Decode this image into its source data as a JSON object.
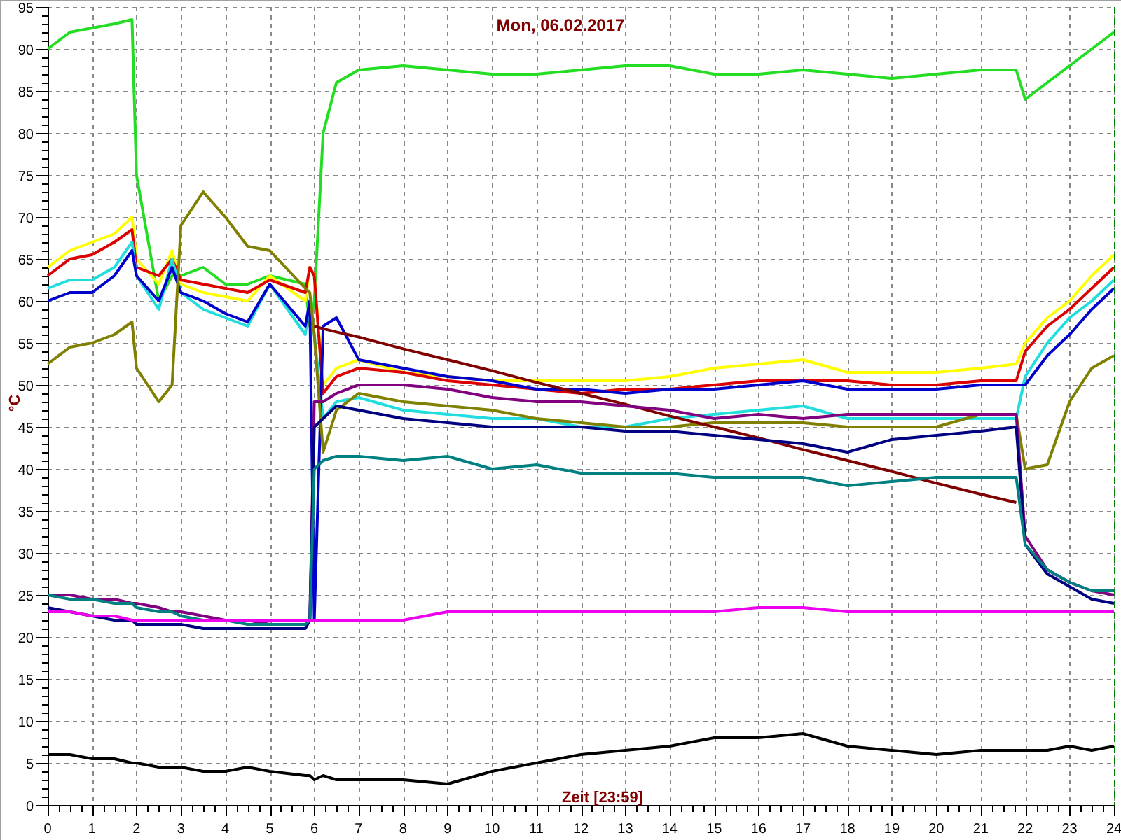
{
  "chart_data": {
    "type": "line",
    "title": "Mon, 06.02.2017",
    "xlabel": "Zeit [23:59]",
    "ylabel": "°C",
    "x": [
      0,
      0.5,
      1,
      1.5,
      1.9,
      2,
      2.5,
      2.8,
      3,
      3.5,
      4,
      4.5,
      5,
      5.8,
      5.9,
      6,
      6.2,
      6.5,
      7,
      8,
      9,
      10,
      11,
      12,
      13,
      14,
      15,
      16,
      17,
      18,
      19,
      20,
      21,
      21.8,
      22,
      22.5,
      23,
      23.5,
      24
    ],
    "grid": true,
    "xlim": [
      0,
      24
    ],
    "ylim": [
      0,
      95
    ],
    "xticks": [
      0,
      1,
      2,
      3,
      4,
      5,
      6,
      7,
      8,
      9,
      10,
      11,
      12,
      13,
      14,
      15,
      16,
      17,
      18,
      19,
      20,
      21,
      22,
      23,
      24
    ],
    "yticks": [
      0,
      5,
      10,
      15,
      20,
      25,
      30,
      35,
      40,
      45,
      50,
      55,
      60,
      65,
      70,
      75,
      80,
      85,
      90,
      95
    ],
    "series": [
      {
        "color": "#22dd22",
        "values": [
          90,
          92,
          92.5,
          93,
          93.5,
          75,
          60,
          63,
          63,
          64,
          62,
          62,
          63,
          62,
          57,
          60,
          80,
          86,
          87.5,
          88,
          87.5,
          87,
          87,
          87.5,
          88,
          88,
          87,
          87,
          87.5,
          87,
          86.5,
          87,
          87.5,
          87.5,
          84,
          86,
          88,
          90,
          92
        ]
      },
      {
        "color": "#ffff00",
        "values": [
          64,
          66,
          67,
          68,
          70,
          65,
          62,
          66,
          62,
          61,
          60.5,
          60,
          63,
          60,
          64,
          63,
          50,
          52,
          53,
          51.5,
          51,
          50.5,
          50.5,
          50.5,
          50.5,
          51,
          52,
          52.5,
          53,
          51.5,
          51.5,
          51.5,
          52,
          52.5,
          55,
          58,
          60,
          63,
          65.5
        ]
      },
      {
        "color": "#dd0000",
        "values": [
          63,
          65,
          65.5,
          67,
          68.5,
          64,
          63,
          65,
          62.5,
          62,
          61.5,
          61,
          62.5,
          61,
          64,
          63,
          49,
          51,
          52,
          51.5,
          50.5,
          50,
          49.5,
          49,
          49.5,
          49.5,
          50,
          50.5,
          50.5,
          50.5,
          50,
          50,
          50.5,
          50.5,
          54,
          57,
          59,
          61.5,
          64
        ]
      },
      {
        "color": "#22dddd",
        "values": [
          61.5,
          62.5,
          62.5,
          64,
          67,
          63,
          59,
          65,
          61,
          59,
          58,
          57,
          62,
          56,
          60,
          56,
          46,
          48,
          48.5,
          47,
          46.5,
          46,
          46,
          45,
          45,
          46,
          46.5,
          47,
          47.5,
          46,
          46,
          46,
          46,
          46,
          51,
          55,
          58,
          60,
          62.5
        ]
      },
      {
        "color": "#0000cc",
        "values": [
          60,
          61,
          61,
          63,
          66,
          63,
          60,
          64,
          61,
          60,
          58.5,
          57.5,
          62,
          57,
          60,
          22,
          57,
          58,
          53,
          52,
          51,
          50.5,
          49.5,
          49.5,
          49,
          49.5,
          49.5,
          50,
          50.5,
          49.5,
          49.5,
          49.5,
          50,
          50,
          50,
          53.5,
          56,
          59,
          61.5
        ]
      },
      {
        "color": "#808000",
        "values": [
          52.5,
          54.5,
          55,
          56,
          57.5,
          52,
          48,
          50,
          69,
          73,
          70,
          66.5,
          66,
          61.5,
          61,
          56,
          42,
          47,
          49,
          48,
          47.5,
          47,
          46,
          45.5,
          45,
          45,
          45.5,
          45.5,
          45.5,
          45,
          45,
          45,
          46.5,
          46.5,
          40,
          40.5,
          48,
          52,
          53.5
        ]
      },
      {
        "color": "#800000",
        "values": [
          null,
          null,
          null,
          null,
          null,
          null,
          null,
          null,
          null,
          null,
          null,
          null,
          null,
          null,
          null,
          57,
          56.7,
          56.3,
          55.7,
          54.3,
          53,
          51.7,
          50.3,
          49,
          47.7,
          46.3,
          45,
          43.7,
          42.3,
          41,
          39.7,
          38.3,
          37,
          36,
          null,
          null,
          null,
          null,
          null
        ]
      },
      {
        "color": "#800080",
        "values": [
          25,
          25,
          24.5,
          24.5,
          24,
          24,
          23.5,
          23,
          23,
          22.5,
          22,
          22,
          21.5,
          21.5,
          22,
          48,
          48,
          49,
          50,
          50,
          49.5,
          48.5,
          48,
          48,
          47.5,
          47,
          46,
          46.5,
          46,
          46.5,
          46.5,
          46.5,
          46.5,
          46.5,
          32,
          28,
          26.5,
          25.5,
          25
        ]
      },
      {
        "color": "#000080",
        "values": [
          23.5,
          23,
          22.5,
          22,
          22,
          21.5,
          21.5,
          21.5,
          21.5,
          21,
          21,
          21,
          21,
          21,
          22,
          45,
          46,
          47.5,
          47,
          46,
          45.5,
          45,
          45,
          45,
          44.5,
          44.5,
          44,
          43.5,
          43,
          42,
          43.5,
          44,
          44.5,
          45,
          31,
          27.5,
          26,
          24.5,
          24
        ]
      },
      {
        "color": "#008080",
        "values": [
          25,
          24.5,
          24.5,
          24,
          24,
          23.5,
          23,
          23,
          22.5,
          22,
          22,
          21.5,
          21.5,
          21.5,
          22,
          40,
          41,
          41.5,
          41.5,
          41,
          41.5,
          40,
          40.5,
          39.5,
          39.5,
          39.5,
          39,
          39,
          39,
          38,
          38.5,
          39,
          39,
          39,
          31,
          28,
          26.5,
          25.5,
          25.5
        ]
      },
      {
        "color": "#ee00ee",
        "values": [
          23,
          23,
          22.5,
          22.5,
          22,
          22,
          22,
          22,
          22,
          22,
          22,
          22,
          22,
          22,
          22,
          22,
          22,
          22,
          22,
          22,
          23,
          23,
          23,
          23,
          23,
          23,
          23,
          23.5,
          23.5,
          23,
          23,
          23,
          23,
          23,
          23,
          23,
          23,
          23,
          23
        ]
      },
      {
        "color": "#000000",
        "values": [
          6,
          6,
          5.5,
          5.5,
          5,
          5,
          4.5,
          4.5,
          4.5,
          4,
          4,
          4.5,
          4,
          3.5,
          3.5,
          3,
          3.5,
          3,
          3,
          3,
          2.5,
          4,
          5,
          6,
          6.5,
          7,
          8,
          8,
          8.5,
          7,
          6.5,
          6,
          6.5,
          6.5,
          6.5,
          6.5,
          7,
          6.5,
          7
        ]
      }
    ]
  }
}
